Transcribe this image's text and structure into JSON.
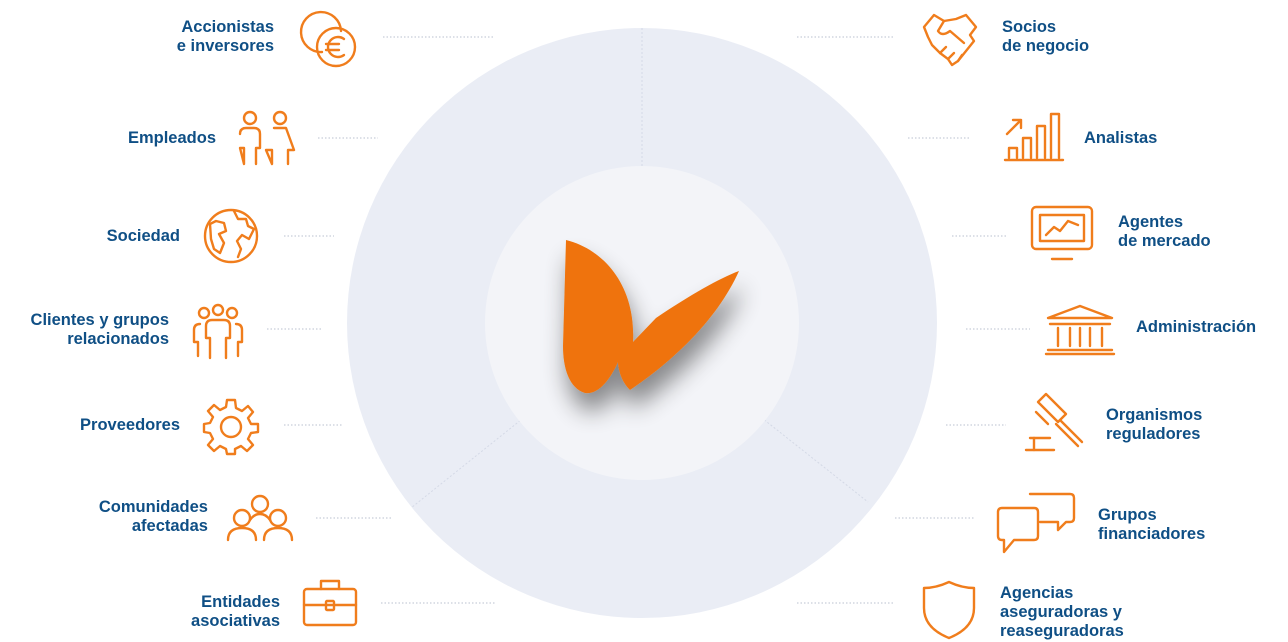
{
  "colors": {
    "accent": "#f07d1c",
    "label": "#0f4f85",
    "outer_ring": "#eaedf5",
    "inner_disc": "#f3f4f8"
  },
  "center_logo": "logo-wing",
  "left_items": [
    {
      "lines": [
        "Accionistas",
        "e inversores"
      ],
      "icon": "euro-coins-icon"
    },
    {
      "lines": [
        "Empleados"
      ],
      "icon": "employees-icon"
    },
    {
      "lines": [
        "Sociedad"
      ],
      "icon": "globe-icon"
    },
    {
      "lines": [
        "Clientes y grupos",
        "relacionados"
      ],
      "icon": "group-people-icon"
    },
    {
      "lines": [
        "Proveedores"
      ],
      "icon": "gear-icon"
    },
    {
      "lines": [
        "Comunidades",
        "afectadas"
      ],
      "icon": "community-icon"
    },
    {
      "lines": [
        "Entidades",
        "asociativas"
      ],
      "icon": "briefcase-icon"
    }
  ],
  "right_items": [
    {
      "lines": [
        "Socios",
        "de negocio"
      ],
      "icon": "handshake-icon"
    },
    {
      "lines": [
        "Analistas"
      ],
      "icon": "bar-chart-icon"
    },
    {
      "lines": [
        "Agentes",
        "de mercado"
      ],
      "icon": "monitor-chart-icon"
    },
    {
      "lines": [
        "Administración"
      ],
      "icon": "government-building-icon"
    },
    {
      "lines": [
        "Organismos",
        "reguladores"
      ],
      "icon": "gavel-icon"
    },
    {
      "lines": [
        "Grupos",
        "financiadores"
      ],
      "icon": "chat-bubbles-icon"
    },
    {
      "lines": [
        "Agencias",
        "aseguradoras y",
        "reaseguradoras"
      ],
      "icon": "shield-icon"
    }
  ]
}
